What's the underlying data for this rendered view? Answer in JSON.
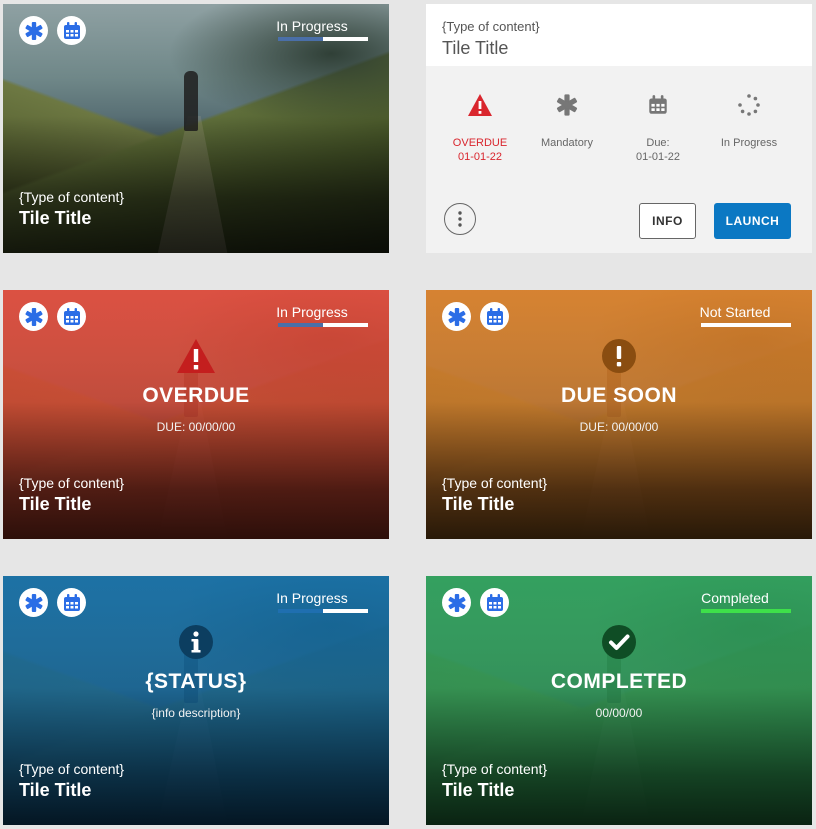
{
  "colors": {
    "badge_icon": "#2b6de6",
    "progress_track": "#ffffff",
    "progress_fill_blue": "#4a6fa8",
    "progress_fill_green": "#3ee04a",
    "overdue_red": "#d9262e",
    "launch_blue": "#0b78c3"
  },
  "icons": {
    "mandatory": "asterisk-icon",
    "due_date": "calendar-icon",
    "overdue": "warning-triangle-icon",
    "due_soon": "exclamation-circle-icon",
    "status": "info-circle-icon",
    "completed": "checkmark-circle-icon",
    "in_progress": "spinner-dots-icon",
    "more": "vertical-dots-icon"
  },
  "tiles": [
    {
      "id": "tile-1",
      "status_label": "In Progress",
      "progress": 0.5,
      "type_label": "{Type of content}",
      "title": "Tile Title"
    },
    {
      "id": "tile-2",
      "type_label": "{Type of content}",
      "title": "Tile Title",
      "meta": [
        {
          "label": "OVERDUE\n01-01-22",
          "line1": "OVERDUE",
          "line2": "01-01-22"
        },
        {
          "line1": "Mandatory",
          "line2": ""
        },
        {
          "line1": "Due:",
          "line2": "01-01-22"
        },
        {
          "line1": "In Progress",
          "line2": ""
        }
      ],
      "info_button": "INFO",
      "launch_button": "LAUNCH"
    },
    {
      "id": "tile-3",
      "status_label": "In Progress",
      "progress": 0.5,
      "heading": "OVERDUE",
      "subtext": "DUE: 00/00/00",
      "type_label": "{Type of content}",
      "title": "Tile Title"
    },
    {
      "id": "tile-4",
      "status_label": "Not Started",
      "progress": 0,
      "heading": "DUE SOON",
      "subtext": "DUE: 00/00/00",
      "type_label": "{Type of content}",
      "title": "Tile Title"
    },
    {
      "id": "tile-5",
      "status_label": "In Progress",
      "progress": 0.5,
      "heading": "{STATUS}",
      "subtext": "{info description}",
      "type_label": "{Type of content}",
      "title": "Tile Title"
    },
    {
      "id": "tile-6",
      "status_label": "Completed",
      "progress": 1,
      "heading": "COMPLETED",
      "subtext": "00/00/00",
      "type_label": "{Type of content}",
      "title": "Tile Title"
    }
  ]
}
